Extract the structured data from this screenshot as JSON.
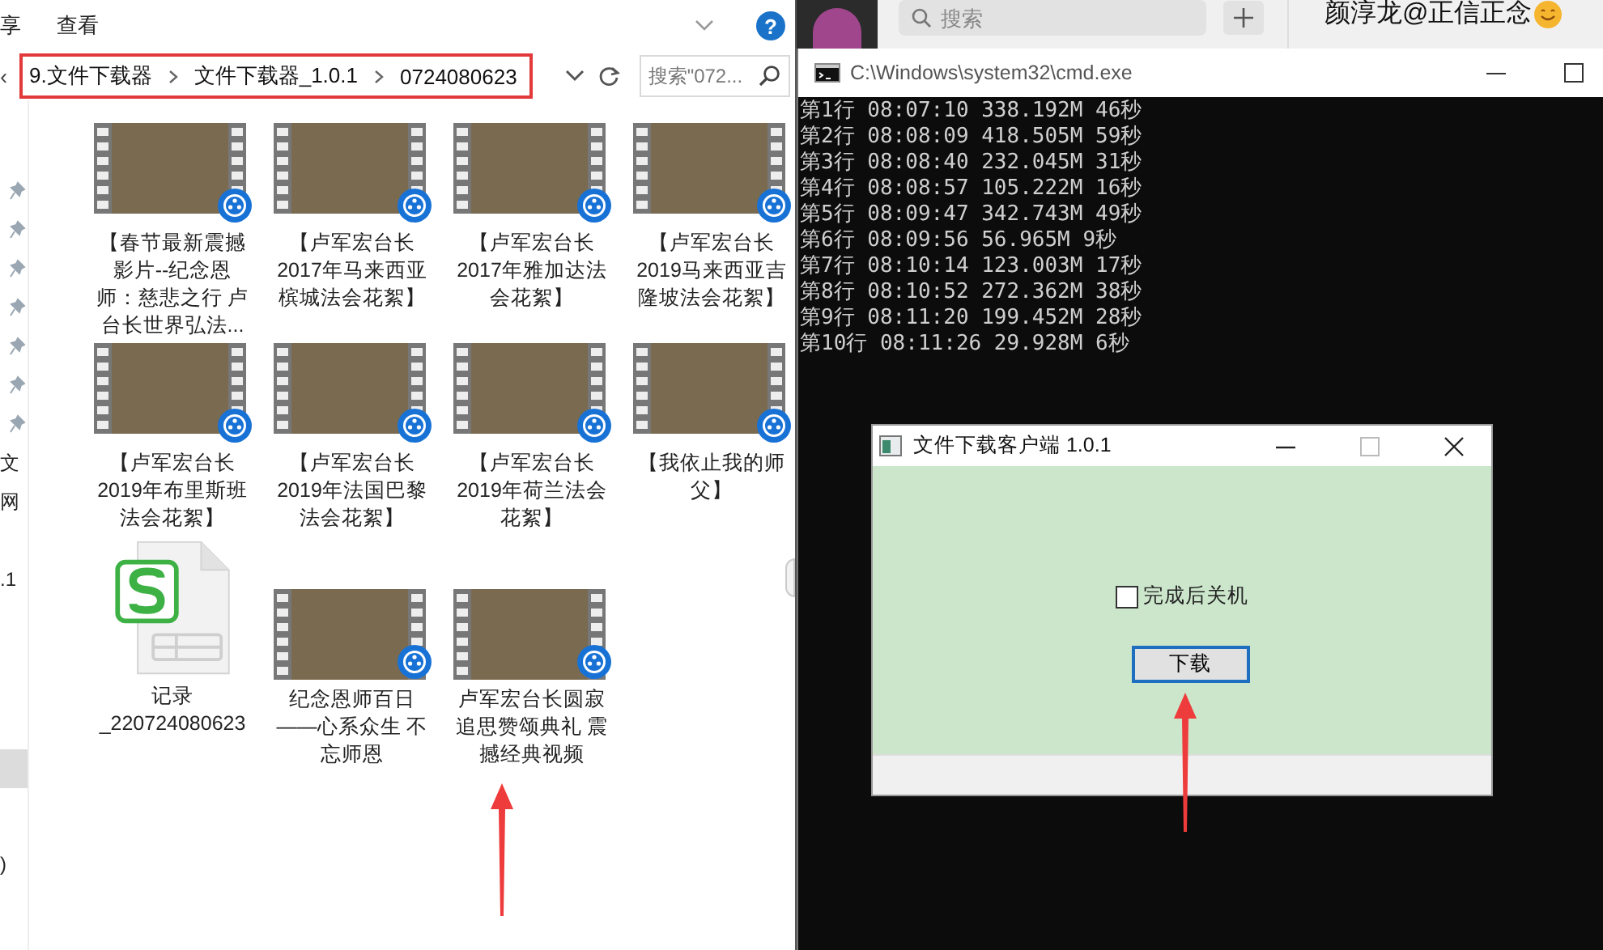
{
  "explorer": {
    "ribbon_tabs": [
      "享",
      "查看"
    ],
    "help_label": "?",
    "back_caret": "‹",
    "breadcrumb": [
      "9.文件下载器",
      "文件下载器_1.0.1",
      "0724080623"
    ],
    "search": {
      "placeholder": "搜索\"072..."
    },
    "nav_items": [
      {
        "pinned": true,
        "selected": false
      },
      {
        "pinned": true,
        "selected": false
      },
      {
        "pinned": true,
        "selected": false
      },
      {
        "pinned": true,
        "selected": false
      },
      {
        "pinned": true,
        "selected": false
      },
      {
        "pinned": true,
        "selected": false
      },
      {
        "pinned": true,
        "selected": false
      },
      {
        "label": "文",
        "pinned": false,
        "selected": false
      },
      {
        "label": "网",
        "pinned": false,
        "selected": false
      },
      {
        "label": ".1",
        "pinned": false,
        "selected": false
      },
      {
        "pinned": false,
        "selected": true
      },
      {
        "label": ")",
        "pinned": false,
        "selected": false
      }
    ],
    "files": [
      {
        "kind": "video",
        "name": "【春节最新震撼影片--纪念恩师：慈悲之行 卢台长世界弘法..."
      },
      {
        "kind": "video",
        "name": "【卢军宏台长2017年马来西亚槟城法会花絮】"
      },
      {
        "kind": "video",
        "name": "【卢军宏台长2017年雅加达法会花絮】"
      },
      {
        "kind": "video",
        "name": "【卢军宏台长2019马来西亚吉隆坡法会花絮】"
      },
      {
        "kind": "video",
        "name": "【卢军宏台长2019年布里斯班法会花絮】"
      },
      {
        "kind": "video",
        "name": "【卢军宏台长2019年法国巴黎法会花絮】"
      },
      {
        "kind": "video",
        "name": "【卢军宏台长2019年荷兰法会花絮】"
      },
      {
        "kind": "video",
        "name": "【我依止我的师父】"
      },
      {
        "kind": "spreadsheet",
        "name": "记录_220724080623"
      },
      {
        "kind": "video",
        "name": "纪念恩师百日——心系众生 不忘师恩"
      },
      {
        "kind": "video",
        "name": "卢军宏台长圆寂追思赞颂典礼 震撼经典视频"
      }
    ]
  },
  "chat_app": {
    "search": {
      "placeholder": "搜索"
    },
    "contact_name": "颜淳龙@正信正念"
  },
  "console": {
    "title": "C:\\Windows\\system32\\cmd.exe",
    "lines": [
      "第1行 08:07:10 338.192M 46秒",
      "第2行 08:08:09 418.505M 59秒",
      "第3行 08:08:40 232.045M 31秒",
      "第4行 08:08:57 105.222M 16秒",
      "第5行 08:09:47 342.743M 49秒",
      "第6行 08:09:56 56.965M 9秒",
      "第7行 08:10:14 123.003M 17秒",
      "第8行 08:10:52 272.362M 38秒",
      "第9行 08:11:20 199.452M 28秒",
      "第10行 08:11:26 29.928M 6秒"
    ]
  },
  "dialog": {
    "title": "文件下载客户端 1.0.1",
    "checkbox": {
      "label": "完成后关机",
      "checked": false
    },
    "button": "下载"
  }
}
